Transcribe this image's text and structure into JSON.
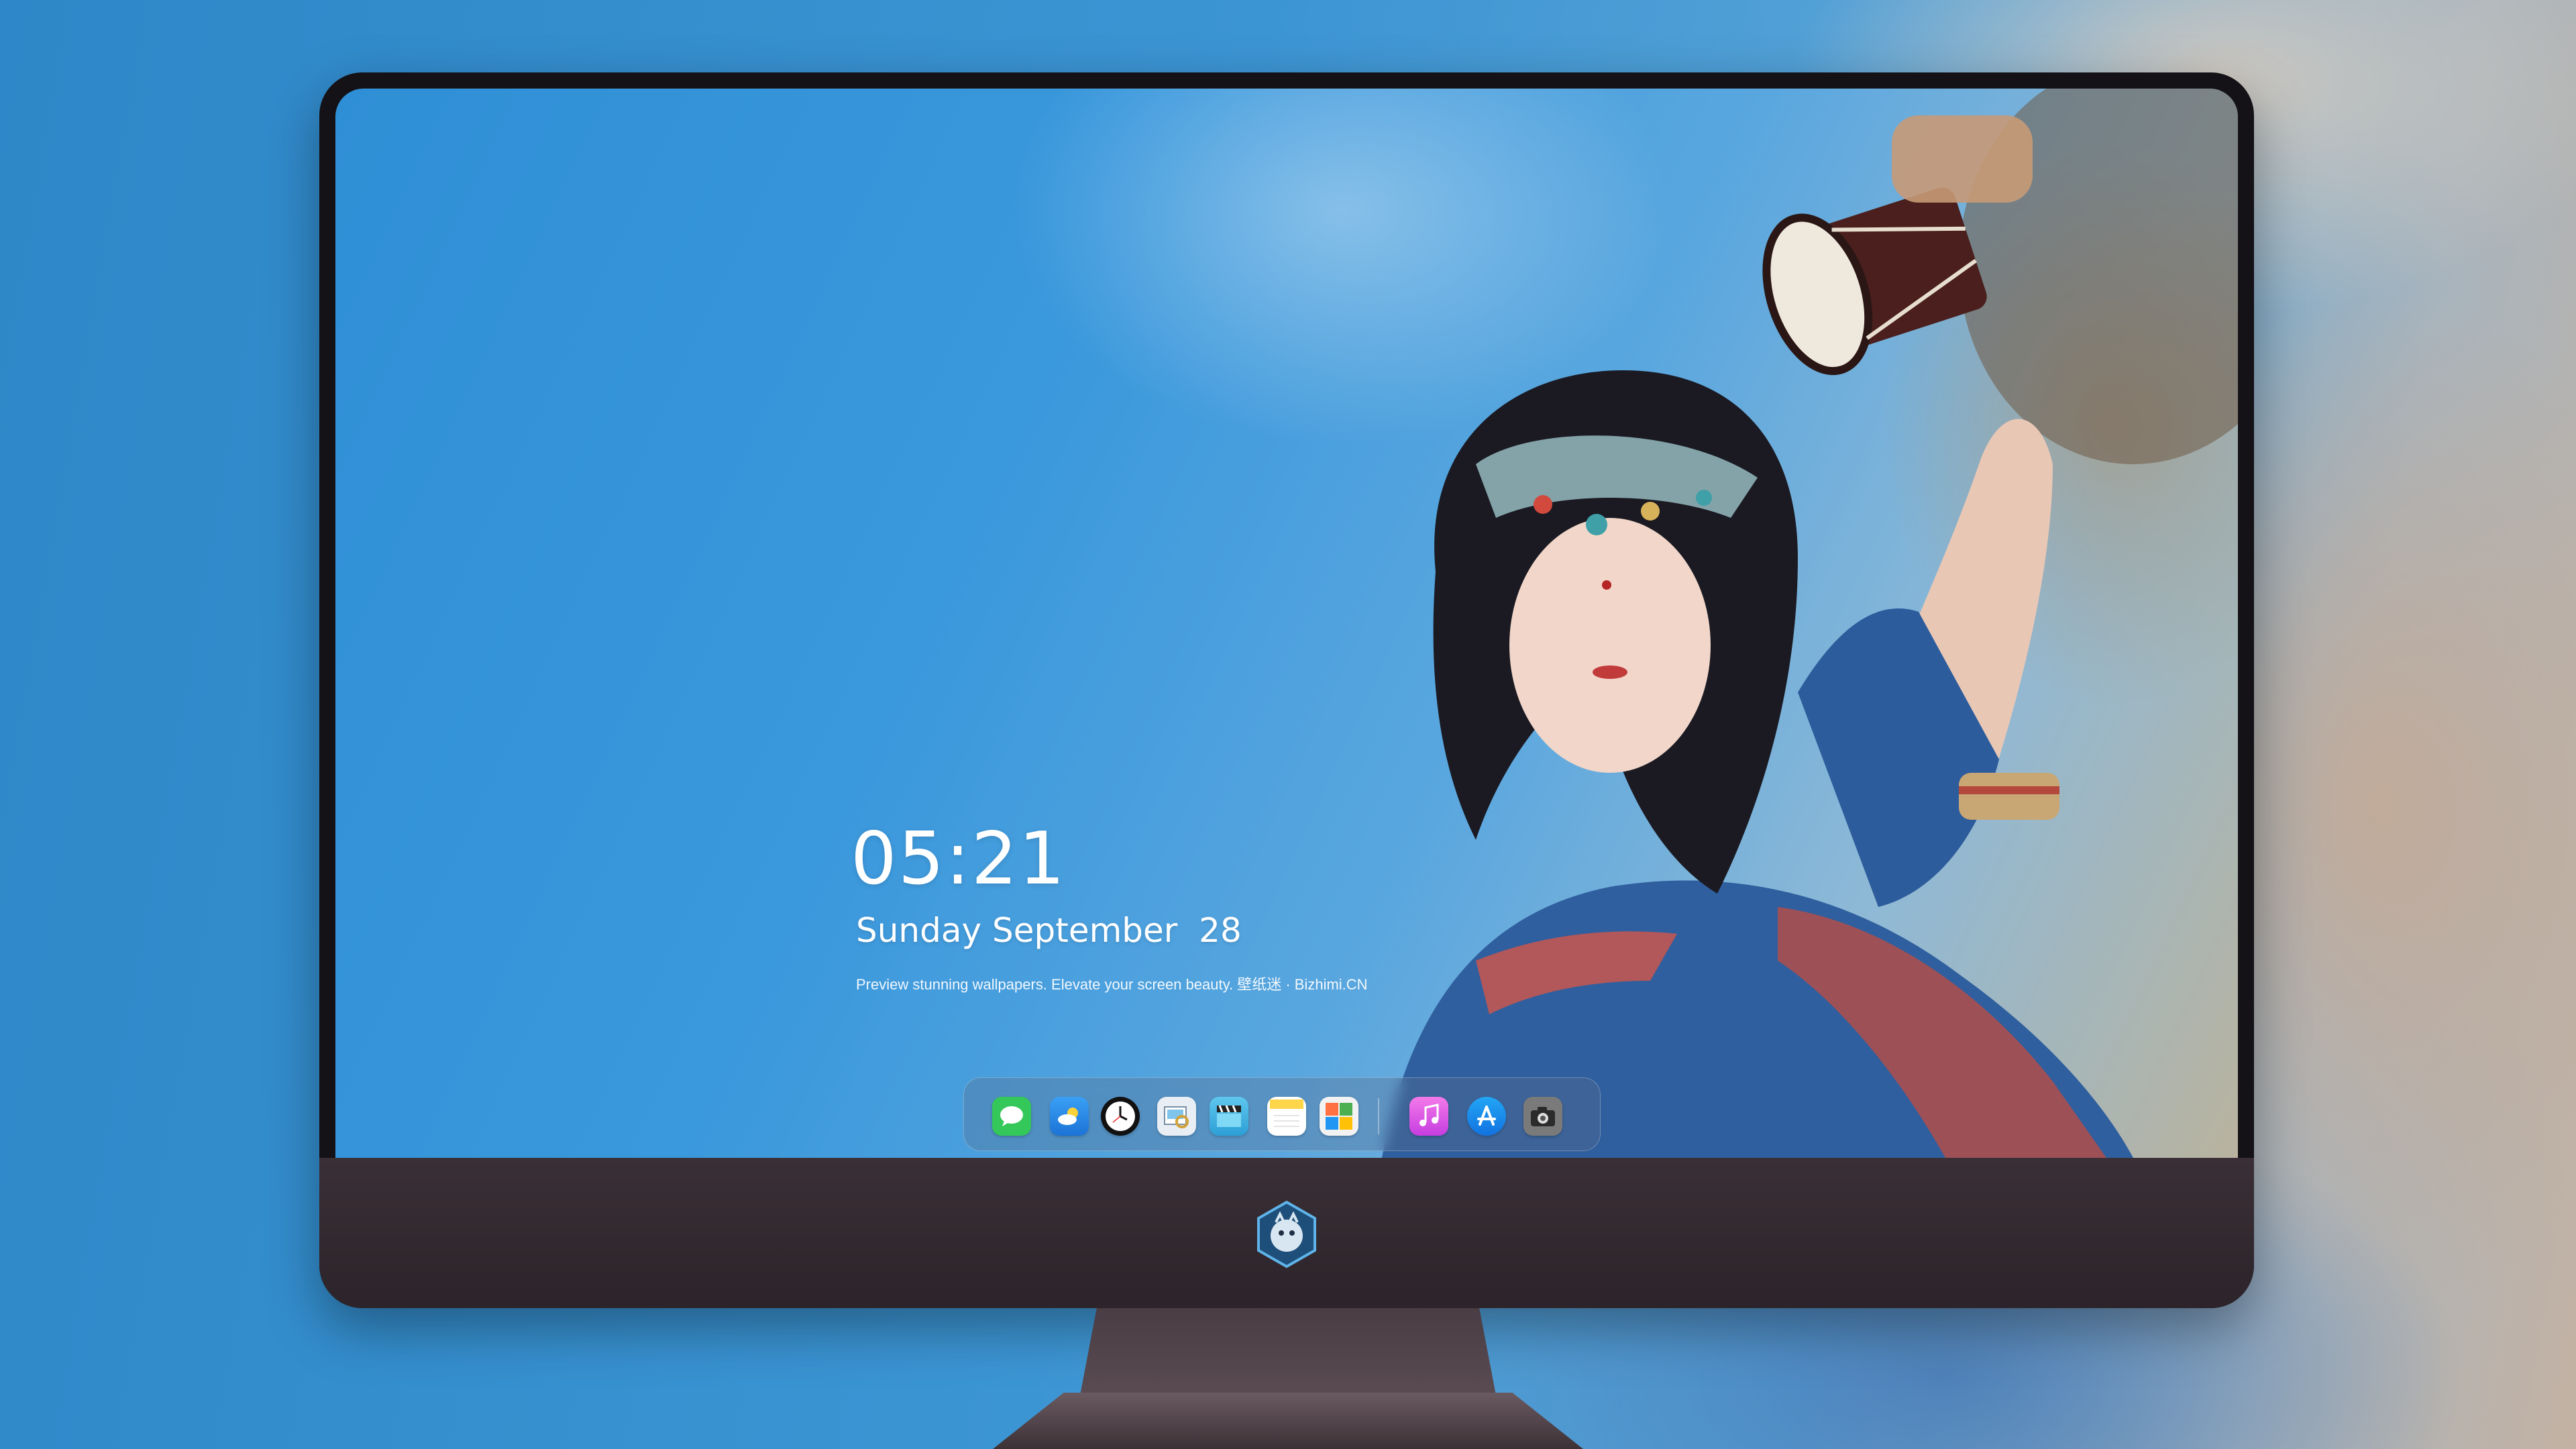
{
  "lockscreen": {
    "time": "05:21",
    "date": "Sunday September  28",
    "tagline": "Preview stunning wallpapers. Elevate your screen beauty. 壁纸迷 · Bizhimi.CN"
  },
  "dock": {
    "apps": [
      {
        "name": "messages-icon",
        "color": "#34c759"
      },
      {
        "name": "weather-icon",
        "color": "#2f8ff0"
      },
      {
        "name": "clock-icon",
        "color": "#111111"
      },
      {
        "name": "preview-icon",
        "color": "#e9eef4"
      },
      {
        "name": "final-cut-icon",
        "color": "#49b8e8"
      },
      {
        "name": "notes-icon",
        "color": "#ffd54a"
      },
      {
        "name": "photo-booth-icon",
        "color": "#f2f2f2"
      },
      {
        "name": "music-icon",
        "color": "#e657e8"
      },
      {
        "name": "app-store-icon",
        "color": "#1f8ef1"
      },
      {
        "name": "screenshot-icon",
        "color": "#6b6b6b"
      }
    ]
  }
}
